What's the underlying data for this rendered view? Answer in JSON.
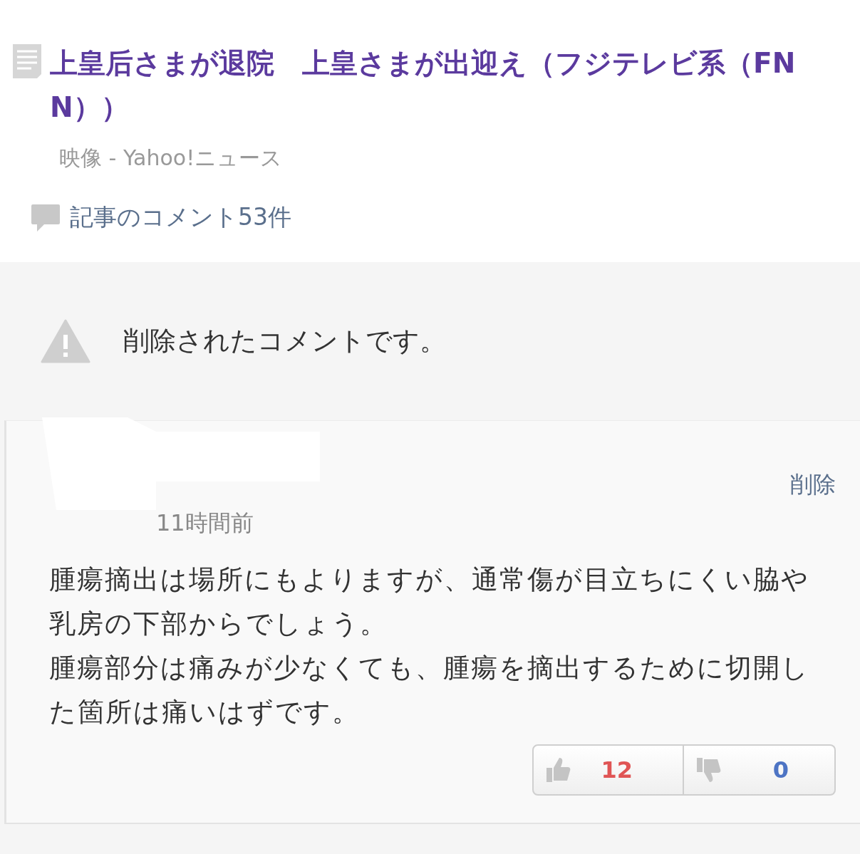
{
  "article": {
    "title": "上皇后さまが退院　上皇さまが出迎え（フジテレビ系（FNN））",
    "source": "映像 - Yahoo!ニュース",
    "comments_link": "記事のコメント53件"
  },
  "deleted_comment": {
    "message": "削除されたコメントです。"
  },
  "reply": {
    "delete_label": "削除",
    "time": "11時間前",
    "body": [
      "腫瘍摘出は場所にもよりますが、通常傷が目立ちにくい脇や乳房の下部からでしょう。",
      "腫瘍部分は痛みが少なくても、腫瘍を摘出するために切開した箇所は痛いはずです。"
    ],
    "likes": "12",
    "dislikes": "0"
  }
}
